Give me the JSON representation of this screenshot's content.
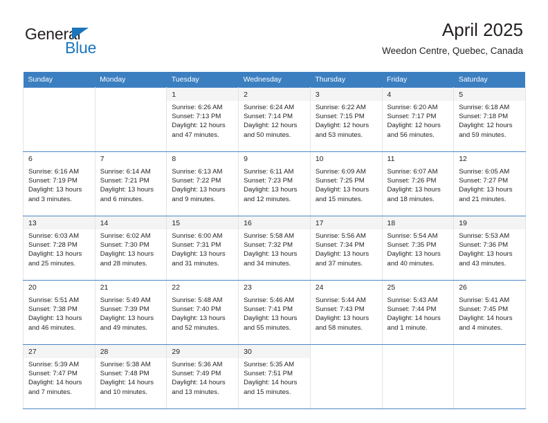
{
  "brand": {
    "name_top": "General",
    "name_bottom": "Blue",
    "accent_color": "#1b75bb"
  },
  "header": {
    "title": "April 2025",
    "subtitle": "Weedon Centre, Quebec, Canada"
  },
  "theme": {
    "header_row_bg": "#3c7fc1",
    "row_shaded_bg": "#f4f4f4",
    "grid_line": "#4a86c5",
    "text": "#231f20"
  },
  "weekdays": [
    "Sunday",
    "Monday",
    "Tuesday",
    "Wednesday",
    "Thursday",
    "Friday",
    "Saturday"
  ],
  "weeks": [
    [
      {
        "day": "",
        "sunrise": "",
        "sunset": "",
        "daylight1": "",
        "daylight2": ""
      },
      {
        "day": "",
        "sunrise": "",
        "sunset": "",
        "daylight1": "",
        "daylight2": ""
      },
      {
        "day": "1",
        "sunrise": "Sunrise: 6:26 AM",
        "sunset": "Sunset: 7:13 PM",
        "daylight1": "Daylight: 12 hours",
        "daylight2": "and 47 minutes."
      },
      {
        "day": "2",
        "sunrise": "Sunrise: 6:24 AM",
        "sunset": "Sunset: 7:14 PM",
        "daylight1": "Daylight: 12 hours",
        "daylight2": "and 50 minutes."
      },
      {
        "day": "3",
        "sunrise": "Sunrise: 6:22 AM",
        "sunset": "Sunset: 7:15 PM",
        "daylight1": "Daylight: 12 hours",
        "daylight2": "and 53 minutes."
      },
      {
        "day": "4",
        "sunrise": "Sunrise: 6:20 AM",
        "sunset": "Sunset: 7:17 PM",
        "daylight1": "Daylight: 12 hours",
        "daylight2": "and 56 minutes."
      },
      {
        "day": "5",
        "sunrise": "Sunrise: 6:18 AM",
        "sunset": "Sunset: 7:18 PM",
        "daylight1": "Daylight: 12 hours",
        "daylight2": "and 59 minutes."
      }
    ],
    [
      {
        "day": "6",
        "sunrise": "Sunrise: 6:16 AM",
        "sunset": "Sunset: 7:19 PM",
        "daylight1": "Daylight: 13 hours",
        "daylight2": "and 3 minutes."
      },
      {
        "day": "7",
        "sunrise": "Sunrise: 6:14 AM",
        "sunset": "Sunset: 7:21 PM",
        "daylight1": "Daylight: 13 hours",
        "daylight2": "and 6 minutes."
      },
      {
        "day": "8",
        "sunrise": "Sunrise: 6:13 AM",
        "sunset": "Sunset: 7:22 PM",
        "daylight1": "Daylight: 13 hours",
        "daylight2": "and 9 minutes."
      },
      {
        "day": "9",
        "sunrise": "Sunrise: 6:11 AM",
        "sunset": "Sunset: 7:23 PM",
        "daylight1": "Daylight: 13 hours",
        "daylight2": "and 12 minutes."
      },
      {
        "day": "10",
        "sunrise": "Sunrise: 6:09 AM",
        "sunset": "Sunset: 7:25 PM",
        "daylight1": "Daylight: 13 hours",
        "daylight2": "and 15 minutes."
      },
      {
        "day": "11",
        "sunrise": "Sunrise: 6:07 AM",
        "sunset": "Sunset: 7:26 PM",
        "daylight1": "Daylight: 13 hours",
        "daylight2": "and 18 minutes."
      },
      {
        "day": "12",
        "sunrise": "Sunrise: 6:05 AM",
        "sunset": "Sunset: 7:27 PM",
        "daylight1": "Daylight: 13 hours",
        "daylight2": "and 21 minutes."
      }
    ],
    [
      {
        "day": "13",
        "sunrise": "Sunrise: 6:03 AM",
        "sunset": "Sunset: 7:28 PM",
        "daylight1": "Daylight: 13 hours",
        "daylight2": "and 25 minutes."
      },
      {
        "day": "14",
        "sunrise": "Sunrise: 6:02 AM",
        "sunset": "Sunset: 7:30 PM",
        "daylight1": "Daylight: 13 hours",
        "daylight2": "and 28 minutes."
      },
      {
        "day": "15",
        "sunrise": "Sunrise: 6:00 AM",
        "sunset": "Sunset: 7:31 PM",
        "daylight1": "Daylight: 13 hours",
        "daylight2": "and 31 minutes."
      },
      {
        "day": "16",
        "sunrise": "Sunrise: 5:58 AM",
        "sunset": "Sunset: 7:32 PM",
        "daylight1": "Daylight: 13 hours",
        "daylight2": "and 34 minutes."
      },
      {
        "day": "17",
        "sunrise": "Sunrise: 5:56 AM",
        "sunset": "Sunset: 7:34 PM",
        "daylight1": "Daylight: 13 hours",
        "daylight2": "and 37 minutes."
      },
      {
        "day": "18",
        "sunrise": "Sunrise: 5:54 AM",
        "sunset": "Sunset: 7:35 PM",
        "daylight1": "Daylight: 13 hours",
        "daylight2": "and 40 minutes."
      },
      {
        "day": "19",
        "sunrise": "Sunrise: 5:53 AM",
        "sunset": "Sunset: 7:36 PM",
        "daylight1": "Daylight: 13 hours",
        "daylight2": "and 43 minutes."
      }
    ],
    [
      {
        "day": "20",
        "sunrise": "Sunrise: 5:51 AM",
        "sunset": "Sunset: 7:38 PM",
        "daylight1": "Daylight: 13 hours",
        "daylight2": "and 46 minutes."
      },
      {
        "day": "21",
        "sunrise": "Sunrise: 5:49 AM",
        "sunset": "Sunset: 7:39 PM",
        "daylight1": "Daylight: 13 hours",
        "daylight2": "and 49 minutes."
      },
      {
        "day": "22",
        "sunrise": "Sunrise: 5:48 AM",
        "sunset": "Sunset: 7:40 PM",
        "daylight1": "Daylight: 13 hours",
        "daylight2": "and 52 minutes."
      },
      {
        "day": "23",
        "sunrise": "Sunrise: 5:46 AM",
        "sunset": "Sunset: 7:41 PM",
        "daylight1": "Daylight: 13 hours",
        "daylight2": "and 55 minutes."
      },
      {
        "day": "24",
        "sunrise": "Sunrise: 5:44 AM",
        "sunset": "Sunset: 7:43 PM",
        "daylight1": "Daylight: 13 hours",
        "daylight2": "and 58 minutes."
      },
      {
        "day": "25",
        "sunrise": "Sunrise: 5:43 AM",
        "sunset": "Sunset: 7:44 PM",
        "daylight1": "Daylight: 14 hours",
        "daylight2": "and 1 minute."
      },
      {
        "day": "26",
        "sunrise": "Sunrise: 5:41 AM",
        "sunset": "Sunset: 7:45 PM",
        "daylight1": "Daylight: 14 hours",
        "daylight2": "and 4 minutes."
      }
    ],
    [
      {
        "day": "27",
        "sunrise": "Sunrise: 5:39 AM",
        "sunset": "Sunset: 7:47 PM",
        "daylight1": "Daylight: 14 hours",
        "daylight2": "and 7 minutes."
      },
      {
        "day": "28",
        "sunrise": "Sunrise: 5:38 AM",
        "sunset": "Sunset: 7:48 PM",
        "daylight1": "Daylight: 14 hours",
        "daylight2": "and 10 minutes."
      },
      {
        "day": "29",
        "sunrise": "Sunrise: 5:36 AM",
        "sunset": "Sunset: 7:49 PM",
        "daylight1": "Daylight: 14 hours",
        "daylight2": "and 13 minutes."
      },
      {
        "day": "30",
        "sunrise": "Sunrise: 5:35 AM",
        "sunset": "Sunset: 7:51 PM",
        "daylight1": "Daylight: 14 hours",
        "daylight2": "and 15 minutes."
      },
      {
        "day": "",
        "sunrise": "",
        "sunset": "",
        "daylight1": "",
        "daylight2": ""
      },
      {
        "day": "",
        "sunrise": "",
        "sunset": "",
        "daylight1": "",
        "daylight2": ""
      },
      {
        "day": "",
        "sunrise": "",
        "sunset": "",
        "daylight1": "",
        "daylight2": ""
      }
    ]
  ]
}
